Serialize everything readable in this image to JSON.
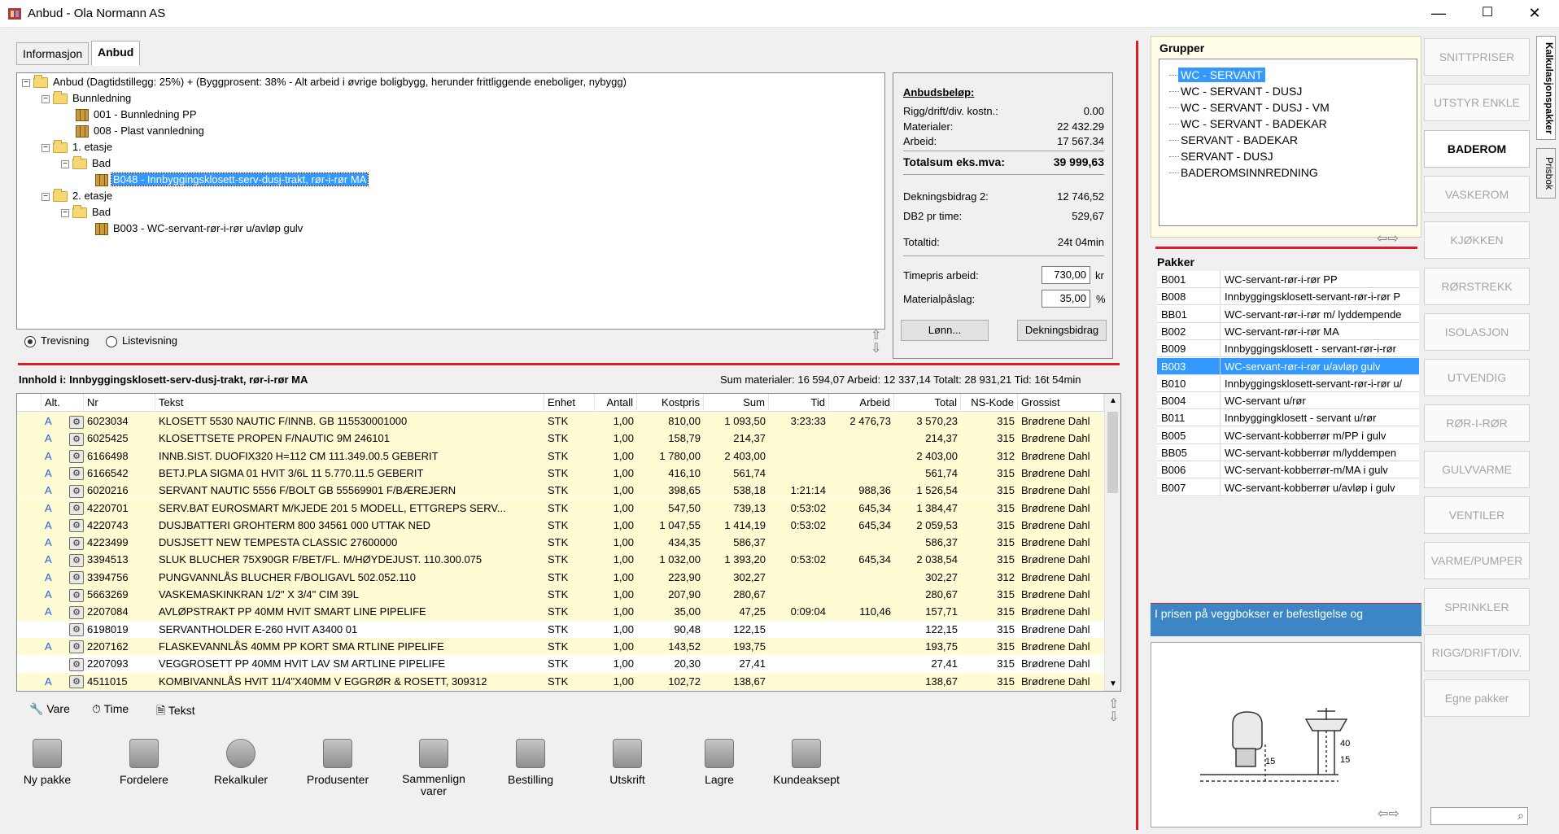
{
  "window": {
    "title": "Anbud - Ola Normann AS",
    "min_glyph": "—",
    "max_glyph": "☐",
    "close_glyph": "✕"
  },
  "tabs": [
    {
      "label": "Informasjon"
    },
    {
      "label": "Anbud"
    }
  ],
  "tree": {
    "root": "Anbud (Dagtidstillegg: 25%) + (Byggprosent: 38% - Alt arbeid i øvrige boligbygg, herunder frittliggende eneboliger, nybygg)",
    "nodes": [
      {
        "label": "Bunnledning"
      },
      {
        "label": "001 - Bunnledning PP"
      },
      {
        "label": "008 - Plast vannledning"
      },
      {
        "label": "1. etasje"
      },
      {
        "label": "Bad"
      },
      {
        "label": "B048 - Innbyggingsklosett-serv-dusj-trakt, rør-i-rør MA"
      },
      {
        "label": "2. etasje"
      },
      {
        "label": "Bad"
      },
      {
        "label": "B003 - WC-servant-rør-i-rør u/avløp gulv"
      }
    ]
  },
  "view": {
    "tree_label": "Trevisning",
    "list_label": "Listevisning"
  },
  "bid": {
    "heading": "Anbudsbeløp:",
    "rigg_label": "Rigg/drift/div. kostn.:",
    "rigg_value": "0.00",
    "materials_label": "Materialer:",
    "materials_value": "22 432.29",
    "work_label": "Arbeid:",
    "work_value": "17 567.34",
    "total_label": "Totalsum eks.mva:",
    "total_value": "39 999,63",
    "db2_label": "Dekningsbidrag 2:",
    "db2_value": "12 746,52",
    "db2_hour_label": "DB2 pr time:",
    "db2_hour_value": "529,67",
    "total_time_label": "Totaltid:",
    "total_time_value": "24t 04min",
    "hourly_label": "Timepris arbeid:",
    "hourly_value": "730,00",
    "hourly_unit": "kr",
    "markup_label": "Materialpåslag:",
    "markup_value": "35,00",
    "markup_unit": "%",
    "salary_button": "Lønn...",
    "contribution_button": "Dekningsbidrag"
  },
  "content": {
    "title": "Innhold i: Innbyggingsklosett-serv-dusj-trakt, rør-i-rør MA",
    "sums": "Sum materialer:  16 594,07  Arbeid:  12 337,14  Totalt:  28 931,21  Tid: 16t 54min"
  },
  "table": {
    "headers": [
      "Alt.",
      "Nr",
      "Tekst",
      "Enhet",
      "Antall",
      "Kostpris",
      "Sum",
      "Tid",
      "Arbeid",
      "Total",
      "NS-Kode",
      "Grossist"
    ],
    "rows": [
      {
        "alt": "A",
        "nr": "6023034",
        "text": "KLOSETT 5530 NAUTIC F/INNB. GB 115530001000",
        "unit": "STK",
        "qty": "1,00",
        "cost": "810,00",
        "sum": "1 093,50",
        "time": "3:23:33",
        "work": "2 476,73",
        "total": "3 570,23",
        "ns": "315",
        "wholesaler": "Brødrene Dahl"
      },
      {
        "alt": "A",
        "nr": "6025425",
        "text": "KLOSETTSETE PROPEN F/NAUTIC 9M 246101",
        "unit": "STK",
        "qty": "1,00",
        "cost": "158,79",
        "sum": "214,37",
        "time": "",
        "work": "",
        "total": "214,37",
        "ns": "315",
        "wholesaler": "Brødrene Dahl"
      },
      {
        "alt": "A",
        "nr": "6166498",
        "text": "INNB.SIST. DUOFIX320 H=112 CM 111.349.00.5 GEBERIT",
        "unit": "STK",
        "qty": "1,00",
        "cost": "1 780,00",
        "sum": "2 403,00",
        "time": "",
        "work": "",
        "total": "2 403,00",
        "ns": "312",
        "wholesaler": "Brødrene Dahl"
      },
      {
        "alt": "A",
        "nr": "6166542",
        "text": "BETJ.PLA SIGMA 01 HVIT 3/6L 11 5.770.11.5 GEBERIT",
        "unit": "STK",
        "qty": "1,00",
        "cost": "416,10",
        "sum": "561,74",
        "time": "",
        "work": "",
        "total": "561,74",
        "ns": "315",
        "wholesaler": "Brødrene Dahl"
      },
      {
        "alt": "A",
        "nr": "6020216",
        "text": "SERVANT NAUTIC 5556 F/BOLT GB 55569901 F/BÆREJERN",
        "unit": "STK",
        "qty": "1,00",
        "cost": "398,65",
        "sum": "538,18",
        "time": "1:21:14",
        "work": "988,36",
        "total": "1 526,54",
        "ns": "315",
        "wholesaler": "Brødrene Dahl"
      },
      {
        "alt": "A",
        "nr": "4220701",
        "text": "SERV.BAT EUROSMART M/KJEDE 201 5 MODELL, ETTGREPS SERV...",
        "unit": "STK",
        "qty": "1,00",
        "cost": "547,50",
        "sum": "739,13",
        "time": "0:53:02",
        "work": "645,34",
        "total": "1 384,47",
        "ns": "315",
        "wholesaler": "Brødrene Dahl"
      },
      {
        "alt": "A",
        "nr": "4220743",
        "text": "DUSJBATTERI GROHTERM 800 34561 000 UTTAK NED",
        "unit": "STK",
        "qty": "1,00",
        "cost": "1 047,55",
        "sum": "1 414,19",
        "time": "0:53:02",
        "work": "645,34",
        "total": "2 059,53",
        "ns": "315",
        "wholesaler": "Brødrene Dahl"
      },
      {
        "alt": "A",
        "nr": "4223499",
        "text": "DUSJSETT NEW TEMPESTA CLASSIC 27600000",
        "unit": "STK",
        "qty": "1,00",
        "cost": "434,35",
        "sum": "586,37",
        "time": "",
        "work": "",
        "total": "586,37",
        "ns": "315",
        "wholesaler": "Brødrene Dahl"
      },
      {
        "alt": "A",
        "nr": "3394513",
        "text": "SLUK BLUCHER 75X90GR F/BET/FL. M/HØYDEJUST.      110.300.075",
        "unit": "STK",
        "qty": "1,00",
        "cost": "1 032,00",
        "sum": "1 393,20",
        "time": "0:53:02",
        "work": "645,34",
        "total": "2 038,54",
        "ns": "315",
        "wholesaler": "Brødrene Dahl"
      },
      {
        "alt": "A",
        "nr": "3394756",
        "text": "PUNGVANNLÅS BLUCHER F/BOLIGAVL 502.052.110",
        "unit": "STK",
        "qty": "1,00",
        "cost": "223,90",
        "sum": "302,27",
        "time": "",
        "work": "",
        "total": "302,27",
        "ns": "312",
        "wholesaler": "Brødrene Dahl"
      },
      {
        "alt": "A",
        "nr": "5663269",
        "text": "VASKEMASKINKRAN    1/2\" X 3/4\" CIM 39L",
        "unit": "STK",
        "qty": "1,00",
        "cost": "207,90",
        "sum": "280,67",
        "time": "",
        "work": "",
        "total": "280,67",
        "ns": "315",
        "wholesaler": "Brødrene Dahl"
      },
      {
        "alt": "A",
        "nr": "2207084",
        "text": "AVLØPSTRAKT PP 40MM HVIT SMART LINE PIPELIFE",
        "unit": "STK",
        "qty": "1,00",
        "cost": "35,00",
        "sum": "47,25",
        "time": "0:09:04",
        "work": "110,46",
        "total": "157,71",
        "ns": "315",
        "wholesaler": "Brødrene Dahl"
      },
      {
        "alt": "",
        "nr": "6198019",
        "text": "SERVANTHOLDER E-260 HVIT A3400 01",
        "unit": "STK",
        "qty": "1,00",
        "cost": "90,48",
        "sum": "122,15",
        "time": "",
        "work": "",
        "total": "122,15",
        "ns": "315",
        "wholesaler": "Brødrene Dahl"
      },
      {
        "alt": "A",
        "nr": "2207162",
        "text": "FLASKEVANNLÅS 40MM PP KORT SMA RTLINE PIPELIFE",
        "unit": "STK",
        "qty": "1,00",
        "cost": "143,52",
        "sum": "193,75",
        "time": "",
        "work": "",
        "total": "193,75",
        "ns": "315",
        "wholesaler": "Brødrene Dahl"
      },
      {
        "alt": "",
        "nr": "2207093",
        "text": "VEGGROSETT PP 40MM HVIT LAV SM ARTLINE PIPELIFE",
        "unit": "STK",
        "qty": "1,00",
        "cost": "20,30",
        "sum": "27,41",
        "time": "",
        "work": "",
        "total": "27,41",
        "ns": "315",
        "wholesaler": "Brødrene Dahl"
      },
      {
        "alt": "A",
        "nr": "4511015",
        "text": "KOMBIVANNLÅS HVIT 11/4\"X40MM V EGGRØR & ROSETT, 309312",
        "unit": "STK",
        "qty": "1,00",
        "cost": "102,72",
        "sum": "138,67",
        "time": "",
        "work": "",
        "total": "138,67",
        "ns": "315",
        "wholesaler": "Brødrene Dahl"
      }
    ]
  },
  "legend": {
    "vare": "Vare",
    "time": "Time",
    "tekst": "Tekst"
  },
  "toolbar": [
    {
      "label": "Ny pakke"
    },
    {
      "label": "Fordelere"
    },
    {
      "label": "Rekalkuler"
    },
    {
      "label": "Produsenter"
    },
    {
      "label": "Sammenlign varer"
    },
    {
      "label": "Bestilling"
    },
    {
      "label": "Utskrift"
    },
    {
      "label": "Lagre"
    },
    {
      "label": "Kundeaksept"
    }
  ],
  "groups": {
    "heading": "Grupper",
    "items": [
      "WC - SERVANT",
      "WC - SERVANT - DUSJ",
      "WC - SERVANT - DUSJ - VM",
      "WC - SERVANT - BADEKAR",
      "SERVANT - BADEKAR",
      "SERVANT - DUSJ",
      "BADEROMSINNREDNING"
    ]
  },
  "packages": {
    "heading": "Pakker",
    "items": [
      {
        "code": "B001",
        "name": "WC-servant-rør-i-rør PP"
      },
      {
        "code": "B008",
        "name": "Innbyggingsklosett-servant-rør-i-rør P"
      },
      {
        "code": "BB01",
        "name": "WC-servant-rør-i-rør m/ lyddempende"
      },
      {
        "code": "B002",
        "name": "WC-servant-rør-i-rør MA"
      },
      {
        "code": "B009",
        "name": "Innbyggingsklosett - servant-rør-i-rør"
      },
      {
        "code": "B003",
        "name": "WC-servant-rør-i-rør u/avløp gulv"
      },
      {
        "code": "B010",
        "name": "Innbyggingsklosett-servant-rør-i-rør u/"
      },
      {
        "code": "B004",
        "name": "WC-servant u/rør"
      },
      {
        "code": "B011",
        "name": "Innbyggingklosett - servant u/rør"
      },
      {
        "code": "B005",
        "name": "WC-servant-kobberrør m/PP i gulv"
      },
      {
        "code": "BB05",
        "name": "WC-servant-kobberrør m/lyddempen"
      },
      {
        "code": "B006",
        "name": "WC-servant-kobberrør-m/MA i gulv"
      },
      {
        "code": "B007",
        "name": "WC-servant-kobberrør u/avløp i gulv"
      }
    ]
  },
  "info_text": "I prisen på veggbokser er befestigelse og",
  "diagram": {
    "dim_a": "15",
    "dim_b": "40",
    "dim_c": "15"
  },
  "categories": [
    "SNITTPRISER",
    "UTSTYR ENKLE",
    "BADEROM",
    "VASKEROM",
    "KJØKKEN",
    "RØRSTREKK",
    "ISOLASJON",
    "UTVENDIG",
    "RØR-I-RØR",
    "GULVVARME",
    "VENTILER",
    "VARME/PUMPER",
    "SPRINKLER",
    "RIGG/DRIFT/DIV.",
    "Egne pakker"
  ],
  "side_tabs": {
    "a": "Kalkulasjonspakker",
    "b": "Prisbok"
  },
  "colors": {
    "selection": "#3399ff",
    "highlight_row": "#fffbd2",
    "red_separator": "#e01b24",
    "info_bar": "#3d86c6"
  }
}
